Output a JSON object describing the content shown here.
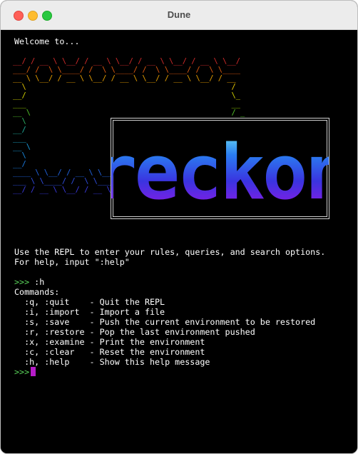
{
  "window": {
    "title": "Dune"
  },
  "terminal": {
    "welcome": "Welcome to...",
    "banner_rows": [
      {
        "text": "__/ / __ \\ \\__/ / __ \\ \\__/ / __ \\ \\__/ / __ \\ \\__/",
        "color": "#d62b2b"
      },
      {
        "text": "___/ /  \\ \\____/ /  \\ \\____/ /  \\ \\____/ /  \\ \\____",
        "color": "#e05a10"
      },
      {
        "text": "__ \\ \\__/ / __ \\ \\__/ / __ \\ \\__/ / __ \\ \\__/ / __",
        "color": "#e8a000"
      },
      {
        "text": "  \\                                              /",
        "color": "#e8c800"
      },
      {
        "text": "__/                                              \\_",
        "color": "#d4d400"
      },
      {
        "text": "___                                              __",
        "color": "#9ad000"
      },
      {
        "text": "__ \\                                             / _",
        "color": "#52c52a"
      },
      {
        "text": "  \\                                             /",
        "color": "#30b868"
      },
      {
        "text": "__/                                             \\_",
        "color": "#22b2a0"
      },
      {
        "text": "___                                             __",
        "color": "#1ea8c8"
      },
      {
        "text": "__ \\                                            / _",
        "color": "#1a9ee0"
      },
      {
        "text": "  \\                                            /",
        "color": "#1a8de6"
      },
      {
        "text": "__/                                            \\__",
        "color": "#1a7ce6"
      },
      {
        "text": "____ \\ \\__/ / __ \\ \\__/ / __ \\ \\__/ / __ \\ \\__/ / _",
        "color": "#2266e6"
      },
      {
        "text": "___ \\ \\____/ /  \\ \\____/ /  \\ \\____/ /  \\ \\____/ /",
        "color": "#3050e6"
      },
      {
        "text": "__/ / __ \\ \\__/ / __ \\ \\__/ / __ \\ \\__/ / __ \\ \\__/",
        "color": "#3c3ce6"
      }
    ],
    "logo_text": "reckon",
    "help_intro": [
      "Use the REPL to enter your rules, queries, and search options.",
      "For help, input \":help\""
    ],
    "prompt": ">>>",
    "command": ":h",
    "commands_header": "Commands:",
    "commands": [
      "  :q, :quit    - Quit the REPL",
      "  :i, :import  - Import a file",
      "  :s, :save    - Push the current environment to be restored",
      "  :r, :restore - Pop the last environment pushed",
      "  :x, :examine - Print the environment",
      "  :c, :clear   - Reset the environment",
      "  :h, :help    - Show this help message"
    ],
    "cursor_color": "#b61cc8"
  }
}
